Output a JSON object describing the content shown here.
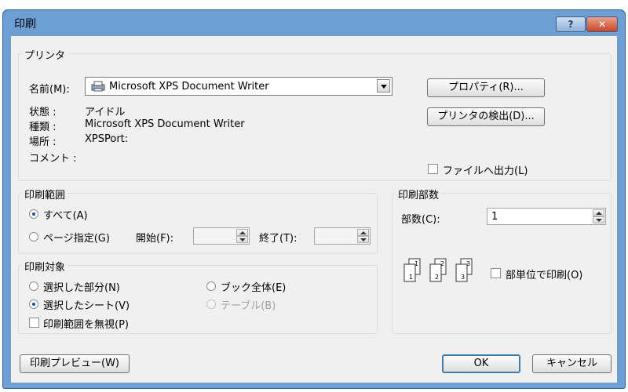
{
  "window": {
    "title": "印刷",
    "help_label": "?",
    "close_label": "✕"
  },
  "printer": {
    "group_label": "プリンタ",
    "name_label": "名前(M):",
    "name_value": "Microsoft XPS Document Writer",
    "status_label": "状態 :",
    "status_value": "アイドル",
    "type_label": "種類 :",
    "type_value": "Microsoft XPS Document Writer",
    "location_label": "場所 :",
    "location_value": "XPSPort:",
    "comment_label": "コメント :",
    "properties_button": "プロパティ(R)...",
    "find_printer_button": "プリンタの検出(D)...",
    "print_to_file_label": "ファイルへ出力(L)"
  },
  "range": {
    "group_label": "印刷範囲",
    "all_label": "すべて(A)",
    "pages_label": "ページ指定(G)",
    "from_label": "開始(F):",
    "to_label": "終了(T):"
  },
  "what": {
    "group_label": "印刷対象",
    "selection_label": "選択した部分(N)",
    "active_sheets_label": "選択したシート(V)",
    "workbook_label": "ブック全体(E)",
    "table_label": "テーブル(B)",
    "ignore_areas_label": "印刷範囲を無視(P)"
  },
  "copies": {
    "group_label": "印刷部数",
    "count_label": "部数(C):",
    "count_value": "1",
    "collate_label": "部単位で印刷(O)",
    "collate_digits": [
      "1",
      "1",
      "2",
      "2",
      "3",
      "3"
    ]
  },
  "footer": {
    "preview_button": "印刷プレビュー(W)",
    "ok_button": "OK",
    "cancel_button": "キャンセル"
  }
}
